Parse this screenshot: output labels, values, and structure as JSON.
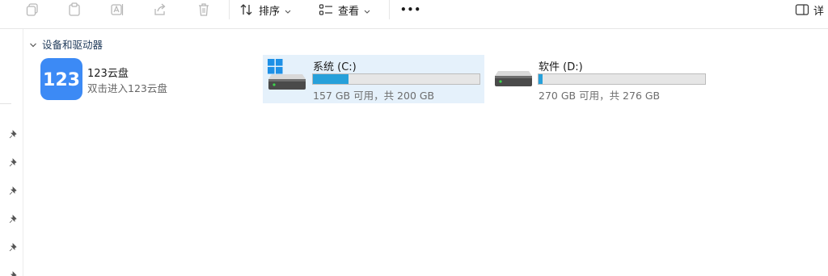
{
  "toolbar": {
    "copy_icon": "copy-icon",
    "paste_icon": "paste-icon",
    "rename_icon": "rename-icon",
    "share_icon": "share-icon",
    "delete_icon": "delete-icon",
    "sort_label": "排序",
    "view_label": "查看",
    "more_label": "•••",
    "details_label": "详"
  },
  "sidebar": {
    "pins": [
      "pin-icon",
      "pin-icon",
      "pin-icon",
      "pin-icon",
      "pin-icon",
      "pin-icon"
    ]
  },
  "section": {
    "title": "设备和驱动器"
  },
  "items": [
    {
      "name": "123云盘",
      "subtitle": "双击进入123云盘",
      "icon": "123-cloud-logo-icon"
    },
    {
      "name": "系统 (C:)",
      "size_text": "157 GB 可用，共 200 GB",
      "used_fraction": 0.215,
      "icon": "system-drive-icon"
    },
    {
      "name": "软件 (D:)",
      "size_text": "270 GB 可用，共 276 GB",
      "used_fraction": 0.022,
      "icon": "drive-icon"
    }
  ],
  "colors": {
    "accent": "#26a0da",
    "selection": "#e5f1fb",
    "app_logo": "#3c8af5"
  }
}
